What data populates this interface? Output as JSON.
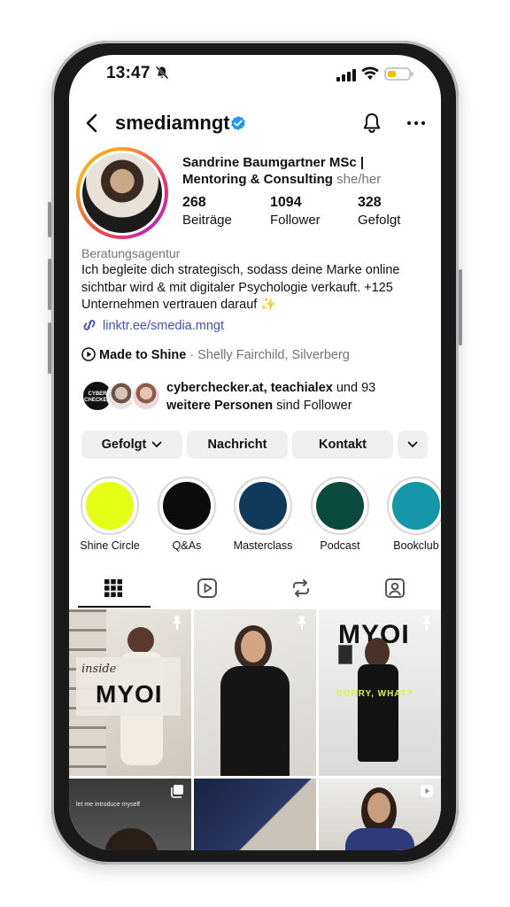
{
  "status_bar": {
    "time": "13:47",
    "battery_level": 0.4
  },
  "header": {
    "username": "smediamngt"
  },
  "profile": {
    "name": "Sandrine Baumgartner MSc | Mentoring & Consulting",
    "pronouns": "she/her",
    "stats": [
      {
        "num": "268",
        "label": "Beiträge"
      },
      {
        "num": "1094",
        "label": "Follower"
      },
      {
        "num": "328",
        "label": "Gefolgt"
      }
    ],
    "category": "Beratungsagentur",
    "bio": "Ich begleite dich strategisch, sodass deine Marke online sichtbar wird & mit digitaler Psychologie verkauft. +125 Unternehmen vertrauen darauf ✨",
    "link": "linktr.ee/smedia.mngt",
    "music_title": "Made to Shine",
    "music_sub": "· Shelly Fairchild, Silverberg",
    "followed_by_names": "cyberchecker.at, teachialex",
    "followed_by_mid": " und 93",
    "followed_by_more": "weitere Personen",
    "followed_by_end": " sind Follower",
    "avatar1_text": "CYBER CHECKER"
  },
  "buttons": {
    "following": "Gefolgt",
    "message": "Nachricht",
    "contact": "Kontakt"
  },
  "highlights": [
    {
      "label": "Shine Circle",
      "color": "#e6ff17"
    },
    {
      "label": "Q&As",
      "color": "#0c0c0c"
    },
    {
      "label": "Masterclass",
      "color": "#0f3a5c"
    },
    {
      "label": "Podcast",
      "color": "#0b4b3d"
    },
    {
      "label": "Bookclub",
      "color": "#1597a9"
    }
  ],
  "posts": {
    "p1_small": "inside",
    "p1_big": "MYOI",
    "p3_big": "MYOI",
    "p3_sub": "SORRY, WHAT?",
    "p4_small": "let me introduce myself"
  },
  "colors": {
    "link": "#3f51c9",
    "verified": "#1d9bf0"
  }
}
